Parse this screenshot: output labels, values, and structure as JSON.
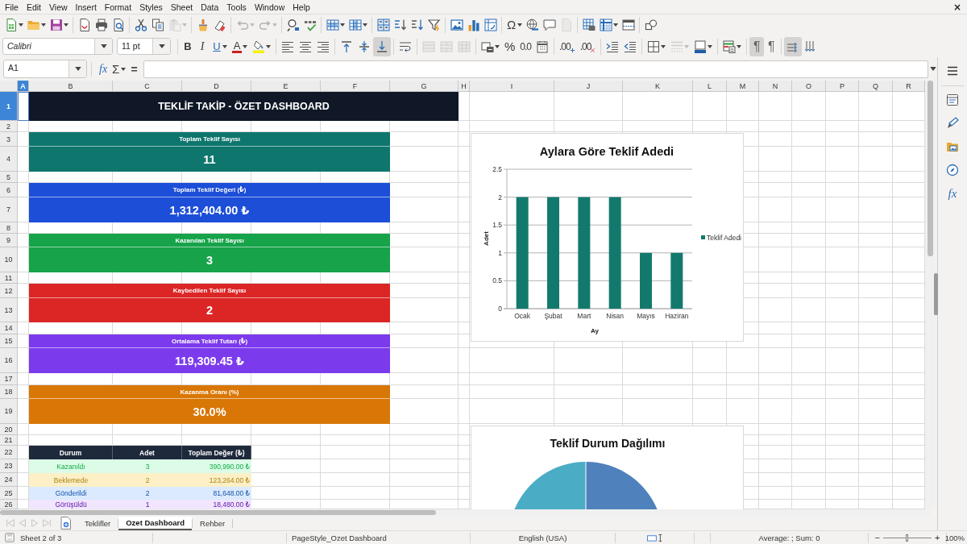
{
  "menu": [
    "File",
    "Edit",
    "View",
    "Insert",
    "Format",
    "Styles",
    "Sheet",
    "Data",
    "Tools",
    "Window",
    "Help"
  ],
  "close_document": "×",
  "standard_toolbar": [
    [
      {
        "kind": "new",
        "disabled": false
      },
      {
        "kind": "open",
        "disabled": false
      },
      {
        "kind": "save",
        "disabled": false
      }
    ],
    [
      {
        "kind": "export-pdf",
        "disabled": false
      },
      {
        "kind": "print",
        "disabled": false
      },
      {
        "kind": "print-preview",
        "disabled": false
      }
    ],
    [
      {
        "kind": "cut",
        "disabled": false
      },
      {
        "kind": "copy",
        "disabled": false
      },
      {
        "kind": "paste",
        "disabled": true
      }
    ],
    [
      {
        "kind": "clone-formatting",
        "disabled": false
      },
      {
        "kind": "clear-formatting",
        "disabled": false
      }
    ],
    [
      {
        "kind": "undo",
        "disabled": true
      },
      {
        "kind": "redo",
        "disabled": true
      }
    ],
    [
      {
        "kind": "find-replace",
        "disabled": false
      },
      {
        "kind": "spelling",
        "disabled": false
      }
    ],
    [
      {
        "kind": "row",
        "disabled": false
      },
      {
        "kind": "column",
        "disabled": false
      }
    ],
    [
      {
        "kind": "sort",
        "disabled": false
      },
      {
        "kind": "sort-ascending",
        "disabled": false
      },
      {
        "kind": "sort-descending",
        "disabled": false
      },
      {
        "kind": "autofilter",
        "disabled": false
      }
    ],
    [
      {
        "kind": "image",
        "disabled": false
      },
      {
        "kind": "chart",
        "disabled": false
      },
      {
        "kind": "pivot-table",
        "disabled": false
      }
    ],
    [
      {
        "kind": "special-character",
        "label": "Ω",
        "disabled": false
      },
      {
        "kind": "hyperlink",
        "disabled": false
      },
      {
        "kind": "comment",
        "disabled": false
      },
      {
        "kind": "header-footer",
        "disabled": true
      }
    ],
    [
      {
        "kind": "print-area",
        "disabled": false
      },
      {
        "kind": "freeze",
        "disabled": false
      },
      {
        "kind": "split-window",
        "disabled": false
      }
    ],
    [
      {
        "kind": "shapes",
        "disabled": false
      }
    ]
  ],
  "formatting_toolbar": {
    "font_name": "Calibri",
    "font_size": "11 pt",
    "groups": [
      [
        {
          "kind": "bold",
          "label": "B",
          "disabled": false,
          "pressed": false
        },
        {
          "kind": "italic",
          "label": "I",
          "disabled": false,
          "pressed": false
        },
        {
          "kind": "underline",
          "label": "U",
          "disabled": false,
          "pressed": false
        },
        {
          "kind": "font-color",
          "label": "A",
          "disabled": false,
          "pressed": false
        },
        {
          "kind": "highlight",
          "disabled": false,
          "pressed": false
        }
      ],
      [
        {
          "kind": "align-left",
          "disabled": false,
          "pressed": false
        },
        {
          "kind": "align-center",
          "disabled": false,
          "pressed": false
        },
        {
          "kind": "align-right",
          "disabled": false,
          "pressed": false
        }
      ],
      [
        {
          "kind": "align-top",
          "disabled": false,
          "pressed": false
        },
        {
          "kind": "align-middle",
          "disabled": false,
          "pressed": false
        },
        {
          "kind": "align-bottom",
          "disabled": false,
          "pressed": true
        }
      ],
      [
        {
          "kind": "wrap-text",
          "disabled": false,
          "pressed": false
        }
      ],
      [
        {
          "kind": "merge-center",
          "disabled": true,
          "pressed": false
        },
        {
          "kind": "merge",
          "disabled": true,
          "pressed": false
        },
        {
          "kind": "unmerge",
          "disabled": true,
          "pressed": false
        }
      ],
      [
        {
          "kind": "number-format",
          "disabled": false,
          "pressed": false
        },
        {
          "kind": "percent",
          "label": "%",
          "disabled": false,
          "pressed": false
        },
        {
          "kind": "number",
          "label": "0.0",
          "disabled": false,
          "pressed": false
        },
        {
          "kind": "date",
          "disabled": false,
          "pressed": false
        }
      ],
      [
        {
          "kind": "add-decimal",
          "label": ".00",
          "disabled": false,
          "pressed": false
        },
        {
          "kind": "delete-decimal",
          "label": ".00",
          "disabled": false,
          "pressed": false
        }
      ],
      [
        {
          "kind": "increase-indent",
          "disabled": false,
          "pressed": false
        },
        {
          "kind": "decrease-indent",
          "disabled": false,
          "pressed": false
        }
      ],
      [
        {
          "kind": "borders",
          "disabled": false,
          "pressed": false
        },
        {
          "kind": "border-style",
          "disabled": true,
          "pressed": false
        },
        {
          "kind": "border-color",
          "disabled": false,
          "pressed": false
        }
      ],
      [
        {
          "kind": "conditional",
          "disabled": false,
          "pressed": false
        }
      ],
      [
        {
          "kind": "left-to-right",
          "label": "¶",
          "disabled": false,
          "pressed": true
        },
        {
          "kind": "right-to-left",
          "label": "¶",
          "disabled": false,
          "pressed": false
        }
      ],
      [
        {
          "kind": "text-horizontal",
          "disabled": false,
          "pressed": true
        },
        {
          "kind": "text-vertical",
          "disabled": false,
          "pressed": false
        }
      ]
    ]
  },
  "formula_bar": {
    "name_box": "A1",
    "function_wizard": "fx",
    "sum": "Σ",
    "formula": "="
  },
  "sidebar": {
    "functions": "fx"
  },
  "sheet": {
    "columns": [
      {
        "label": "A",
        "selected": true
      },
      {
        "label": "B",
        "selected": false
      },
      {
        "label": "C",
        "selected": false
      },
      {
        "label": "D",
        "selected": false
      },
      {
        "label": "E",
        "selected": false
      },
      {
        "label": "F",
        "selected": false
      },
      {
        "label": "G",
        "selected": false
      },
      {
        "label": "H",
        "selected": false
      },
      {
        "label": "I",
        "selected": false
      },
      {
        "label": "J",
        "selected": false
      },
      {
        "label": "K",
        "selected": false
      },
      {
        "label": "L",
        "selected": false
      },
      {
        "label": "M",
        "selected": false
      },
      {
        "label": "N",
        "selected": false
      },
      {
        "label": "O",
        "selected": false
      },
      {
        "label": "P",
        "selected": false
      },
      {
        "label": "Q",
        "selected": false
      },
      {
        "label": "R",
        "selected": false
      }
    ],
    "rows": [
      {
        "label": "1",
        "selected": true
      },
      {
        "label": "2",
        "selected": false
      },
      {
        "label": "3",
        "selected": false
      },
      {
        "label": "4",
        "selected": false
      },
      {
        "label": "5",
        "selected": false
      },
      {
        "label": "6",
        "selected": false
      },
      {
        "label": "7",
        "selected": false
      },
      {
        "label": "8",
        "selected": false
      },
      {
        "label": "9",
        "selected": false
      },
      {
        "label": "10",
        "selected": false
      },
      {
        "label": "11",
        "selected": false
      },
      {
        "label": "12",
        "selected": false
      },
      {
        "label": "13",
        "selected": false
      },
      {
        "label": "14",
        "selected": false
      },
      {
        "label": "15",
        "selected": false
      },
      {
        "label": "16",
        "selected": false
      },
      {
        "label": "17",
        "selected": false
      },
      {
        "label": "18",
        "selected": false
      },
      {
        "label": "19",
        "selected": false
      },
      {
        "label": "20",
        "selected": false
      },
      {
        "label": "21",
        "selected": false
      },
      {
        "label": "22",
        "selected": false
      },
      {
        "label": "23",
        "selected": false
      },
      {
        "label": "24",
        "selected": false
      },
      {
        "label": "25",
        "selected": false
      },
      {
        "label": "26",
        "selected": false
      }
    ]
  },
  "title": "TEKLİF TAKİP - ÖZET DASHBOARD",
  "cards": [
    {
      "label": "Toplam Teklif Sayısı",
      "value": "11",
      "color": "#0f766e"
    },
    {
      "label": "Toplam Teklif Değeri (₺)",
      "value": "1,312,404.00 ₺",
      "color": "#1d4ed8"
    },
    {
      "label": "Kazanılan Teklif Sayısı",
      "value": "3",
      "color": "#16a34a"
    },
    {
      "label": "Kaybedilen Teklif Sayısı",
      "value": "2",
      "color": "#dc2626"
    },
    {
      "label": "Ortalama Teklif Tutarı (₺)",
      "value": "119,309.45 ₺",
      "color": "#7c3aed"
    },
    {
      "label": "Kazanma Oranı (%)",
      "value": "30.0%",
      "color": "#d97706"
    }
  ],
  "status_table": {
    "columns": [
      "Durum",
      "Adet",
      "Toplam Değer (₺)"
    ],
    "rows": [
      {
        "cells": [
          "Kazanıldı",
          "3",
          "390,990.00 ₺"
        ],
        "color": "#dcfce7"
      },
      {
        "cells": [
          "Beklemede",
          "2",
          "123,264.00 ₺"
        ],
        "color": "#fdefc6"
      },
      {
        "cells": [
          "Gönderildi",
          "2",
          "81,648.00 ₺"
        ],
        "color": "#dbeafe"
      },
      {
        "cells": [
          "Görüşüldü",
          "1",
          "18,480.00 ₺"
        ],
        "color": "#f1e6fd"
      }
    ]
  },
  "monthly_chart": {
    "chart_data": {
      "type": "bar",
      "title": "Aylara Göre Teklif Adedi",
      "xlabel": "Ay",
      "ylabel": "Adet",
      "categories": [
        "Ocak",
        "Şubat",
        "Mart",
        "Nisan",
        "Mayıs",
        "Haziran"
      ],
      "series": [
        {
          "name": "Teklif Adedi",
          "color": "#13796d",
          "values": [
            2,
            2,
            2,
            2,
            1,
            1
          ]
        }
      ],
      "ylim": [
        0,
        2.5
      ],
      "yticks": [
        0,
        0.5,
        1,
        1.5,
        2,
        2.5
      ],
      "grid": true
    }
  },
  "status_chart": {
    "title": "Teklif Durum Dağılımı"
  },
  "sheet_tabs": {
    "navigation": [
      {
        "disabled": true
      },
      {
        "disabled": true
      },
      {
        "disabled": true
      },
      {
        "disabled": true
      }
    ],
    "tabs": [
      {
        "label": "Teklifler",
        "selected": false
      },
      {
        "label": "Ozet Dashboard",
        "selected": true
      },
      {
        "label": "Rehber",
        "selected": false
      }
    ]
  },
  "status_bar": {
    "sheet": "Sheet 2 of 3",
    "page_style": "PageStyle_Ozet Dashboard",
    "language": "English (USA)",
    "summary": "Average: ; Sum: 0",
    "zoom_out": "−",
    "zoom_in": "+",
    "zoom": {
      "level": 0.5
    },
    "zoom_reading": "100%"
  }
}
